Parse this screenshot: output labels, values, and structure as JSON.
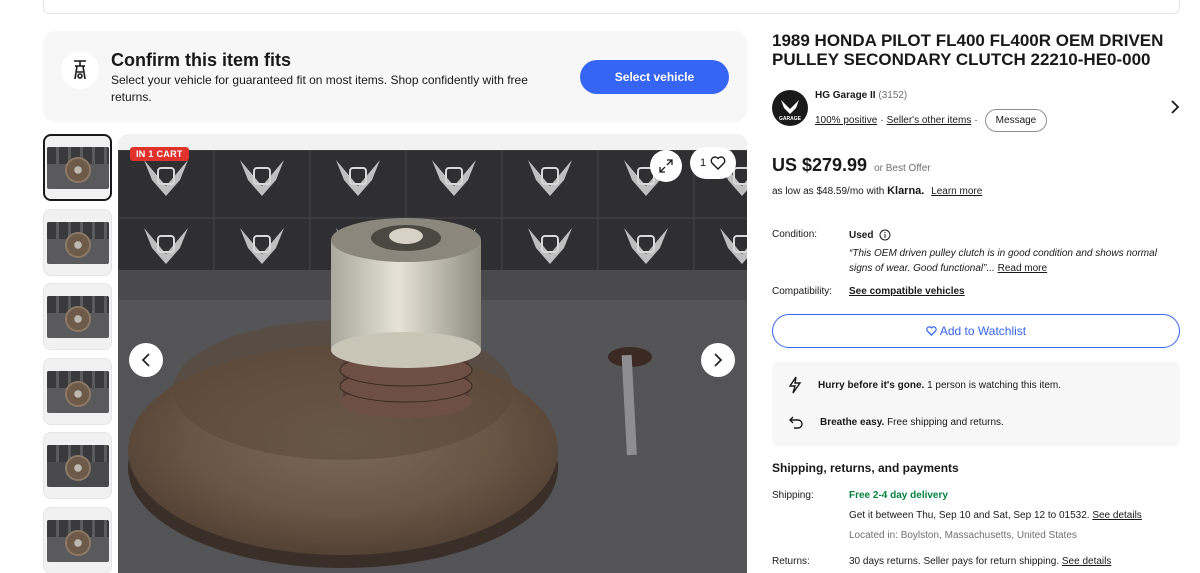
{
  "fit_banner": {
    "title": "Confirm this item fits",
    "subtitle": "Select your vehicle for guaranteed fit on most items. Shop confidently with free returns.",
    "button": "Select vehicle",
    "icon": "motorcycle-icon"
  },
  "gallery": {
    "badge": "IN 1 CART",
    "like_count": "1",
    "thumbnail_count": 6,
    "brand_text": "GARAGE",
    "brand_mark": "HG"
  },
  "product": {
    "title": "1989 HONDA PILOT FL400 FL400R OEM DRIVEN PULLEY SECONDARY CLUTCH 22210-HE0-000",
    "price": "US $279.99",
    "offer": "or Best Offer",
    "klarna_prefix": "as low as $48.59/mo with",
    "klarna_brand": "Klarna.",
    "klarna_link": "Learn more"
  },
  "seller": {
    "name": "HG Garage II",
    "count": "(3152)",
    "positive": "100% positive",
    "sep": "·",
    "other_items": "Seller's other items",
    "message": "Message",
    "logo_text": "GARAGE"
  },
  "details": {
    "condition_label": "Condition:",
    "condition_value": "Used",
    "condition_quote": "“This OEM driven pulley clutch is in good condition and shows normal signs of wear. Good functional”...",
    "read_more": "Read more",
    "compat_label": "Compatibility:",
    "compat_link": "See compatible vehicles"
  },
  "watch_button": "Add to Watchlist",
  "info_box": {
    "hurry_bold": "Hurry before it's gone.",
    "hurry_text": "1 person is watching this item.",
    "easy_bold": "Breathe easy.",
    "easy_text": "Free shipping and returns."
  },
  "shipping": {
    "heading": "Shipping, returns, and payments",
    "ship_label": "Shipping:",
    "ship_value": "Free 2-4 day delivery",
    "ship_dates": "Get it between Thu, Sep 10 and Sat, Sep 12 to 01532.",
    "see_details": "See details",
    "located": "Located in: Boylston, Massachusetts, United States",
    "returns_label": "Returns:",
    "returns_value": "30 days returns. Seller pays for return shipping.",
    "returns_link": "See details"
  },
  "colors": {
    "primary": "#3665f3",
    "badge": "#e0312c",
    "green": "#05823f"
  }
}
